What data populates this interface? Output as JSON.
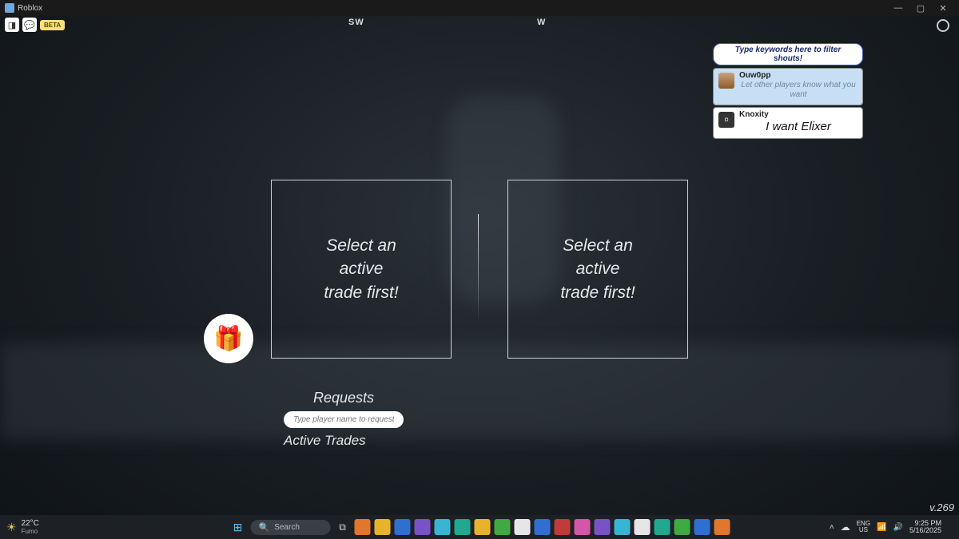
{
  "window": {
    "title": "Roblox"
  },
  "topicons": {
    "beta_badge": "BETA"
  },
  "compass": {
    "sw": "SW",
    "w": "W"
  },
  "shouts": {
    "filter_placeholder": "Type keywords here to filter shouts!",
    "self": {
      "name": "Ouw0pp",
      "placeholder": "Let other players know what you want"
    },
    "others": [
      {
        "name": "Knoxity",
        "message": "I want Elixer"
      }
    ]
  },
  "trade": {
    "left_msg": "Select an\nactive\ntrade first!",
    "right_msg": "Select an\nactive\ntrade first!",
    "icon_emoji": "🎁",
    "requests_label": "Requests",
    "request_input_placeholder": "Type player name to request",
    "active_label": "Active Trades"
  },
  "version": "v.269",
  "taskbar": {
    "temp": "22°C",
    "condition": "Fumo",
    "search_label": "Search",
    "lang_top": "ENG",
    "lang_bot": "US",
    "time": "9:25 PM",
    "date": "5/16/2025"
  }
}
